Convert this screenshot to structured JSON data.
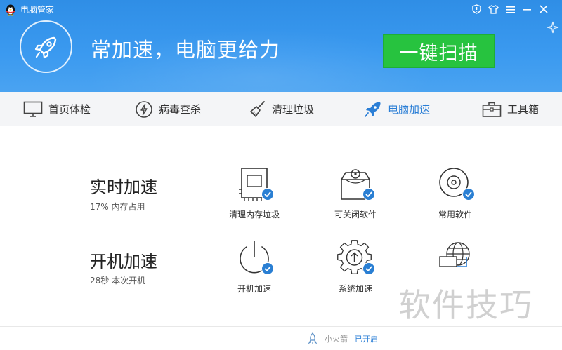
{
  "window": {
    "title": "电脑管家"
  },
  "header": {
    "slogan": "常加速，电脑更给力",
    "scan_button": "一键扫描"
  },
  "nav": {
    "tabs": [
      {
        "label": "首页体检",
        "icon": "monitor-icon",
        "active": false
      },
      {
        "label": "病毒查杀",
        "icon": "lightning-shield-icon",
        "active": false
      },
      {
        "label": "清理垃圾",
        "icon": "broom-icon",
        "active": false
      },
      {
        "label": "电脑加速",
        "icon": "rocket-icon",
        "active": true
      },
      {
        "label": "工具箱",
        "icon": "toolbox-icon",
        "active": false
      }
    ]
  },
  "realtime": {
    "title": "实时加速",
    "subtitle": "17% 内存占用",
    "items": [
      {
        "label": "清理内存垃圾",
        "icon": "memory-chip-icon",
        "checked": true
      },
      {
        "label": "可关闭软件",
        "icon": "software-box-icon",
        "checked": true
      },
      {
        "label": "常用软件",
        "icon": "disc-icon",
        "checked": true
      }
    ]
  },
  "boot": {
    "title": "开机加速",
    "subtitle": "28秒 本次开机",
    "items": [
      {
        "label": "开机加速",
        "icon": "power-icon",
        "checked": true
      },
      {
        "label": "系统加速",
        "icon": "gear-arrow-icon",
        "checked": true
      },
      {
        "label": "",
        "icon": "network-globe-icon",
        "checked": false
      }
    ]
  },
  "footer": {
    "label": "小火箭",
    "state": "已开启"
  },
  "watermark": "软件技巧",
  "colors": {
    "header_blue": "#3b9af0",
    "scan_green": "#27c33f",
    "accent_blue": "#2a7ed6"
  }
}
